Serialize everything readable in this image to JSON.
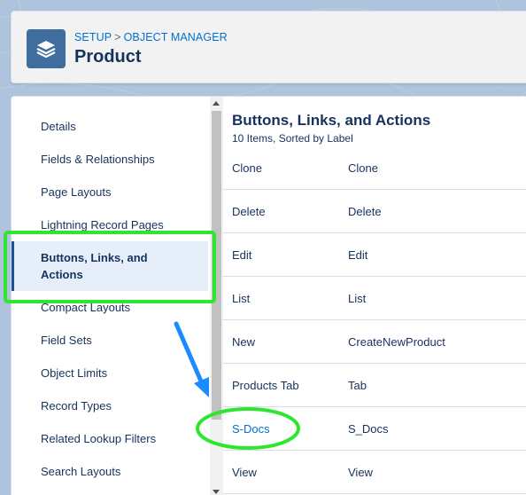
{
  "colors": {
    "accent": "#0070d2",
    "icon_bg": "#3f6d9f",
    "highlight_box": "#2ee62e",
    "arrow": "#1a8cff"
  },
  "header": {
    "icon": "layers-icon",
    "breadcrumb": [
      "SETUP",
      "OBJECT MANAGER"
    ],
    "breadcrumb_separator": ">",
    "title": "Product"
  },
  "sidebar": {
    "items": [
      {
        "label": "Details"
      },
      {
        "label": "Fields & Relationships"
      },
      {
        "label": "Page Layouts"
      },
      {
        "label": "Lightning Record Pages"
      },
      {
        "label": "Buttons, Links, and Actions",
        "active": true
      },
      {
        "label": "Compact Layouts"
      },
      {
        "label": "Field Sets"
      },
      {
        "label": "Object Limits"
      },
      {
        "label": "Record Types"
      },
      {
        "label": "Related Lookup Filters"
      },
      {
        "label": "Search Layouts"
      }
    ]
  },
  "content": {
    "title": "Buttons, Links, and Actions",
    "subtitle": "10 Items, Sorted by Label",
    "rows": [
      {
        "label": "Clone",
        "name": "Clone"
      },
      {
        "label": "Delete",
        "name": "Delete"
      },
      {
        "label": "Edit",
        "name": "Edit"
      },
      {
        "label": "List",
        "name": "List"
      },
      {
        "label": "New",
        "name": "CreateNewProduct"
      },
      {
        "label": "Products Tab",
        "name": "Tab"
      },
      {
        "label": "S-Docs",
        "name": "S_Docs",
        "link": true
      },
      {
        "label": "View",
        "name": "View"
      }
    ]
  }
}
